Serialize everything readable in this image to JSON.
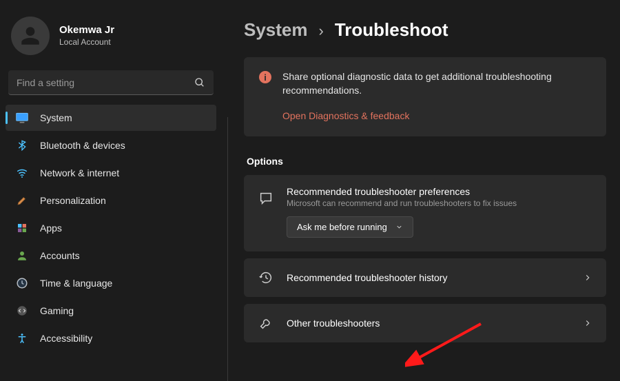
{
  "profile": {
    "name": "Okemwa Jr",
    "sub": "Local Account"
  },
  "search": {
    "placeholder": "Find a setting"
  },
  "nav": [
    {
      "key": "system",
      "label": "System"
    },
    {
      "key": "bluetooth",
      "label": "Bluetooth & devices"
    },
    {
      "key": "network",
      "label": "Network & internet"
    },
    {
      "key": "personalization",
      "label": "Personalization"
    },
    {
      "key": "apps",
      "label": "Apps"
    },
    {
      "key": "accounts",
      "label": "Accounts"
    },
    {
      "key": "time",
      "label": "Time & language"
    },
    {
      "key": "gaming",
      "label": "Gaming"
    },
    {
      "key": "accessibility",
      "label": "Accessibility"
    }
  ],
  "breadcrumb": {
    "parent": "System",
    "sep": "›",
    "current": "Troubleshoot"
  },
  "alert": {
    "text": "Share optional diagnostic data to get additional troubleshooting recommendations.",
    "link": "Open Diagnostics & feedback"
  },
  "options_heading": "Options",
  "pref_card": {
    "title": "Recommended troubleshooter preferences",
    "sub": "Microsoft can recommend and run troubleshooters to fix issues",
    "dropdown": "Ask me before running"
  },
  "history_card": {
    "title": "Recommended troubleshooter history"
  },
  "other_card": {
    "title": "Other troubleshooters"
  }
}
